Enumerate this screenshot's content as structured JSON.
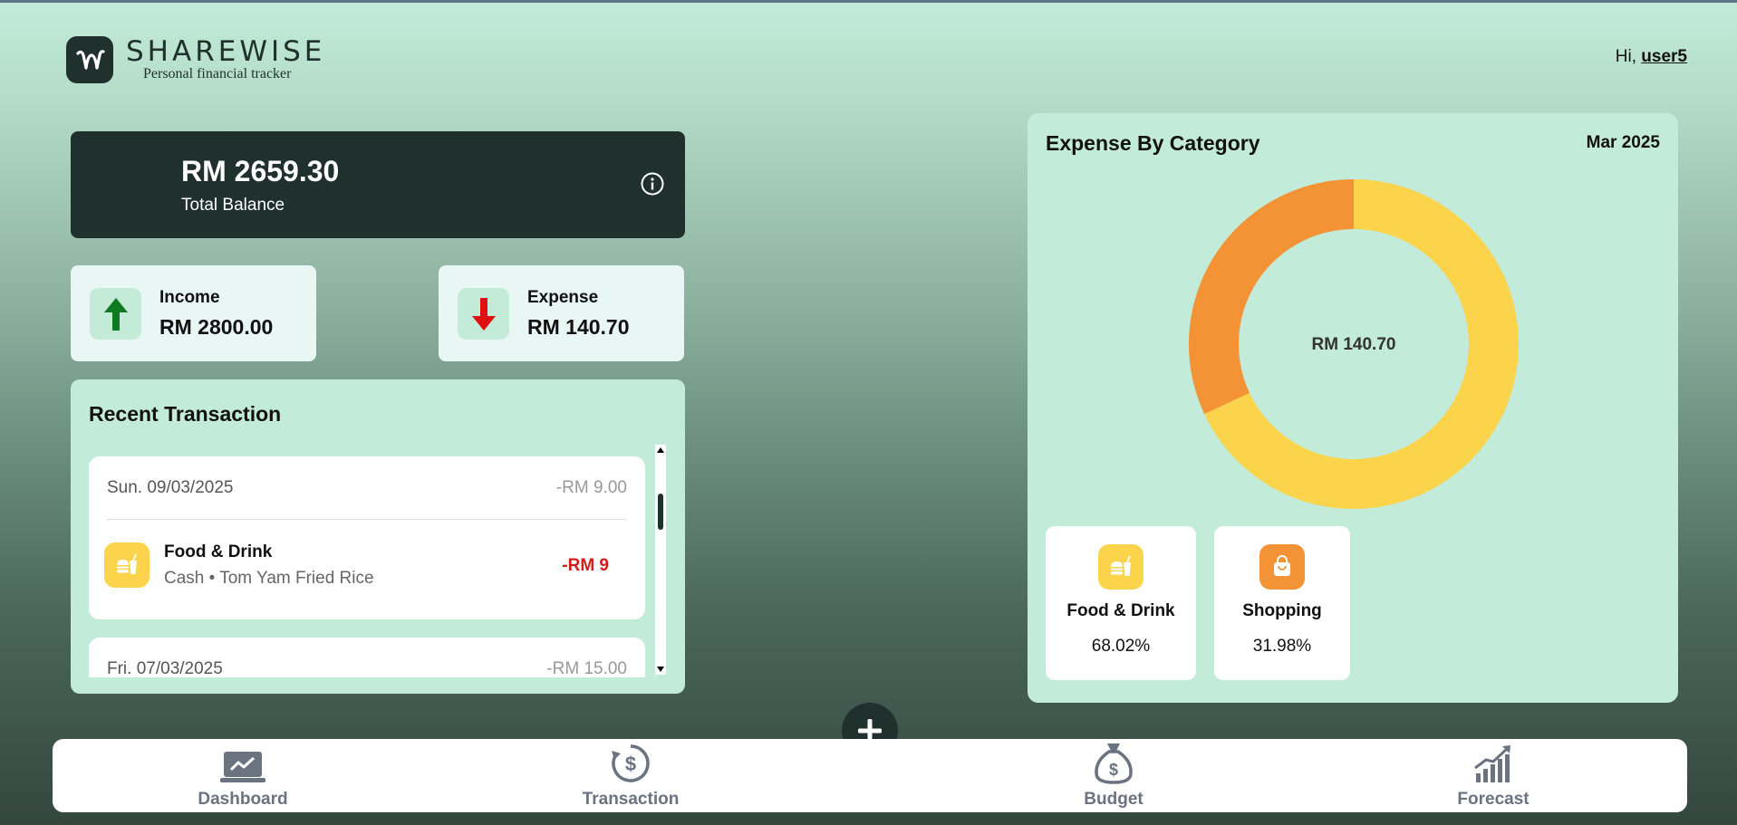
{
  "header": {
    "brand": "SHAREWISE",
    "tagline": "Personal financial tracker",
    "greeting": "Hi,",
    "username": "user5"
  },
  "balance": {
    "amount": "RM 2659.30",
    "label": "Total Balance",
    "info_icon": "info-icon"
  },
  "income": {
    "label": "Income",
    "value": "RM 2800.00",
    "icon": "arrow-up-icon",
    "color": "#0f7a1f"
  },
  "expense": {
    "label": "Expense",
    "value": "RM 140.70",
    "icon": "arrow-down-icon",
    "color": "#e01010"
  },
  "recent": {
    "title": "Recent Transaction",
    "days": [
      {
        "date": "Sun. 09/03/2025",
        "total": "-RM 9.00",
        "items": [
          {
            "category": "Food & Drink",
            "desc": "Cash • Tom Yam Fried Rice",
            "amount": "-RM 9",
            "icon": "food-drink-icon"
          }
        ]
      },
      {
        "date": "Fri. 07/03/2025",
        "total": "-RM 15.00",
        "items": []
      }
    ]
  },
  "category_panel": {
    "title": "Expense By Category",
    "month": "Mar 2025",
    "center_label": "RM 140.70",
    "cards": [
      {
        "name": "Food & Drink",
        "pct": "68.02%",
        "icon": "food-drink-icon",
        "color": "#fbd44b"
      },
      {
        "name": "Shopping",
        "pct": "31.98%",
        "icon": "shopping-bag-icon",
        "color": "#f49335"
      }
    ]
  },
  "chart_data": {
    "type": "pie",
    "title": "Expense By Category",
    "categories": [
      "Food & Drink",
      "Shopping"
    ],
    "values": [
      68.02,
      31.98
    ],
    "colors": [
      "#fbd44b",
      "#f49335"
    ],
    "center_text": "RM 140.70"
  },
  "nav": {
    "items": [
      {
        "label": "Dashboard",
        "icon": "dashboard-icon"
      },
      {
        "label": "Transaction",
        "icon": "transaction-icon"
      },
      {
        "label": "Budget",
        "icon": "budget-icon"
      },
      {
        "label": "Forecast",
        "icon": "forecast-icon"
      }
    ],
    "add_icon": "plus-icon"
  }
}
